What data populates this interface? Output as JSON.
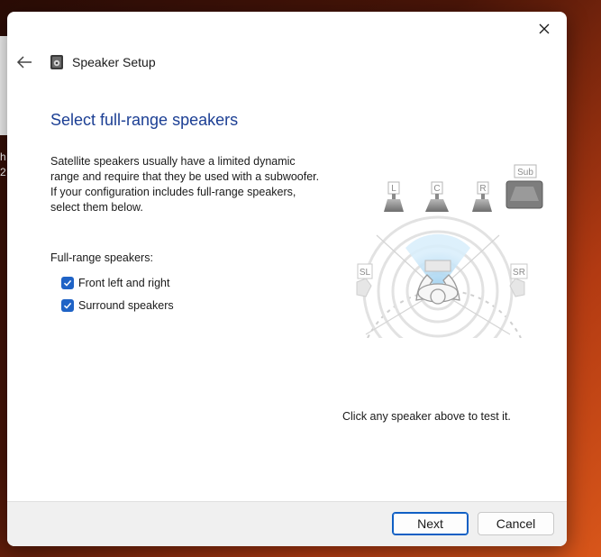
{
  "window": {
    "title": "Speaker Setup",
    "icons": {
      "app": "speaker-setup-icon",
      "back": "back-arrow-icon",
      "close": "close-icon"
    }
  },
  "background": {
    "edge_text": "h\n2"
  },
  "page": {
    "title": "Select full-range speakers",
    "description": "Satellite speakers usually have a limited dynamic range and require that they be used with a subwoofer.  If your configuration includes full-range speakers, select them below."
  },
  "full_range": {
    "label": "Full-range speakers:",
    "options": [
      {
        "label": "Front left and right",
        "checked": true
      },
      {
        "label": "Surround speakers",
        "checked": true
      }
    ]
  },
  "diagram": {
    "speakers": {
      "front_left": "L",
      "center": "C",
      "front_right": "R",
      "subwoofer": "Sub",
      "surround_left": "SL",
      "surround_right": "SR"
    },
    "hint": "Click any speaker above to test it."
  },
  "footer": {
    "next_label": "Next",
    "cancel_label": "Cancel"
  },
  "colors": {
    "accent": "#1f63c6",
    "title": "#1c3f94",
    "footer_bg": "#f0f0f0"
  }
}
